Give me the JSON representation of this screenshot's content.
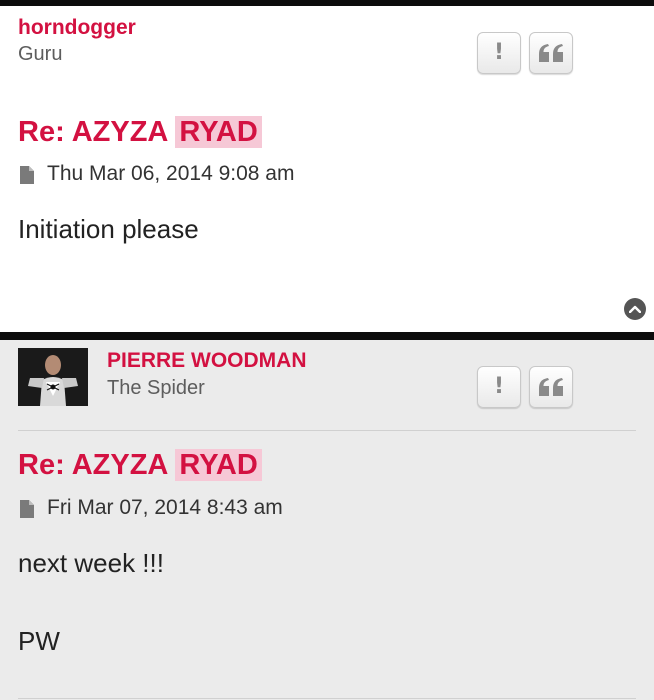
{
  "posts": [
    {
      "username": "horndogger",
      "rank": "Guru",
      "title_prefix": "Re: AZYZA",
      "title_highlight": "RYAD",
      "date": "Thu Mar 06, 2014 9:08 am",
      "content": [
        "Initiation please"
      ],
      "report_icon": "exclamation-icon",
      "quote_icon": "quote-icon"
    },
    {
      "username": "PIERRE WOODMAN",
      "rank": "The Spider",
      "title_prefix": "Re: AZYZA",
      "title_highlight": "RYAD",
      "date": "Fri Mar 07, 2014 8:43 am",
      "content": [
        "next week !!!",
        "PW"
      ],
      "report_icon": "exclamation-icon",
      "quote_icon": "quote-icon"
    }
  ],
  "report_label": "!",
  "back_to_top_icon": "chevron-up-icon",
  "colors": {
    "username": "#d31141",
    "title": "#d31141",
    "highlight_bg": "#f6c8d6",
    "post_alt_bg": "#ebebeb"
  }
}
